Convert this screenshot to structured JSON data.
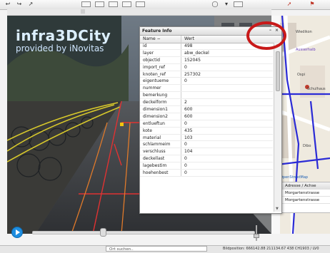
{
  "brand": {
    "title": "infra3DCity",
    "subtitle": "provided by iNovitas"
  },
  "dialog": {
    "title": "Feature Info",
    "col_name": "Name −",
    "col_value": "Wert",
    "minimize": "–",
    "close": "×",
    "rows": [
      {
        "name": "id",
        "value": "498"
      },
      {
        "name": "layer",
        "value": "abw_deckel"
      },
      {
        "name": "objectid",
        "value": "152045"
      },
      {
        "name": "import_ref",
        "value": "0"
      },
      {
        "name": "knoten_ref",
        "value": "257302"
      },
      {
        "name": "eigentueme",
        "value": "0"
      },
      {
        "name": "nummer",
        "value": ""
      },
      {
        "name": "bemerkung",
        "value": ""
      },
      {
        "name": "deckelform",
        "value": "2"
      },
      {
        "name": "dimension1",
        "value": "600"
      },
      {
        "name": "dimension2",
        "value": "600"
      },
      {
        "name": "entlueftun",
        "value": "0"
      },
      {
        "name": "kote",
        "value": "435"
      },
      {
        "name": "material",
        "value": "103"
      },
      {
        "name": "schlammeim",
        "value": "0"
      },
      {
        "name": "verschluss",
        "value": "104"
      },
      {
        "name": "deckellast",
        "value": "0"
      },
      {
        "name": "lagebestim",
        "value": "0"
      },
      {
        "name": "hoehenbest",
        "value": "0"
      }
    ]
  },
  "map": {
    "labels": [
      "Wiedikon",
      "Ausserhalb",
      "Ospi",
      "Schulhaus",
      "Dibo",
      "OpenStreetMap"
    ],
    "results_header": "Adresse / Achse",
    "results": [
      "Morgartenstrasse",
      "Morgartenstrasse"
    ]
  },
  "status": {
    "search_placeholder": "Ort suchen..",
    "position": "Bildposition: 666142.88 211134.67 438  CH1903 / LV0"
  },
  "colors": {
    "accent": "#1d8de0",
    "highlight_ring": "#c81919",
    "route": "#2b2bd6"
  }
}
